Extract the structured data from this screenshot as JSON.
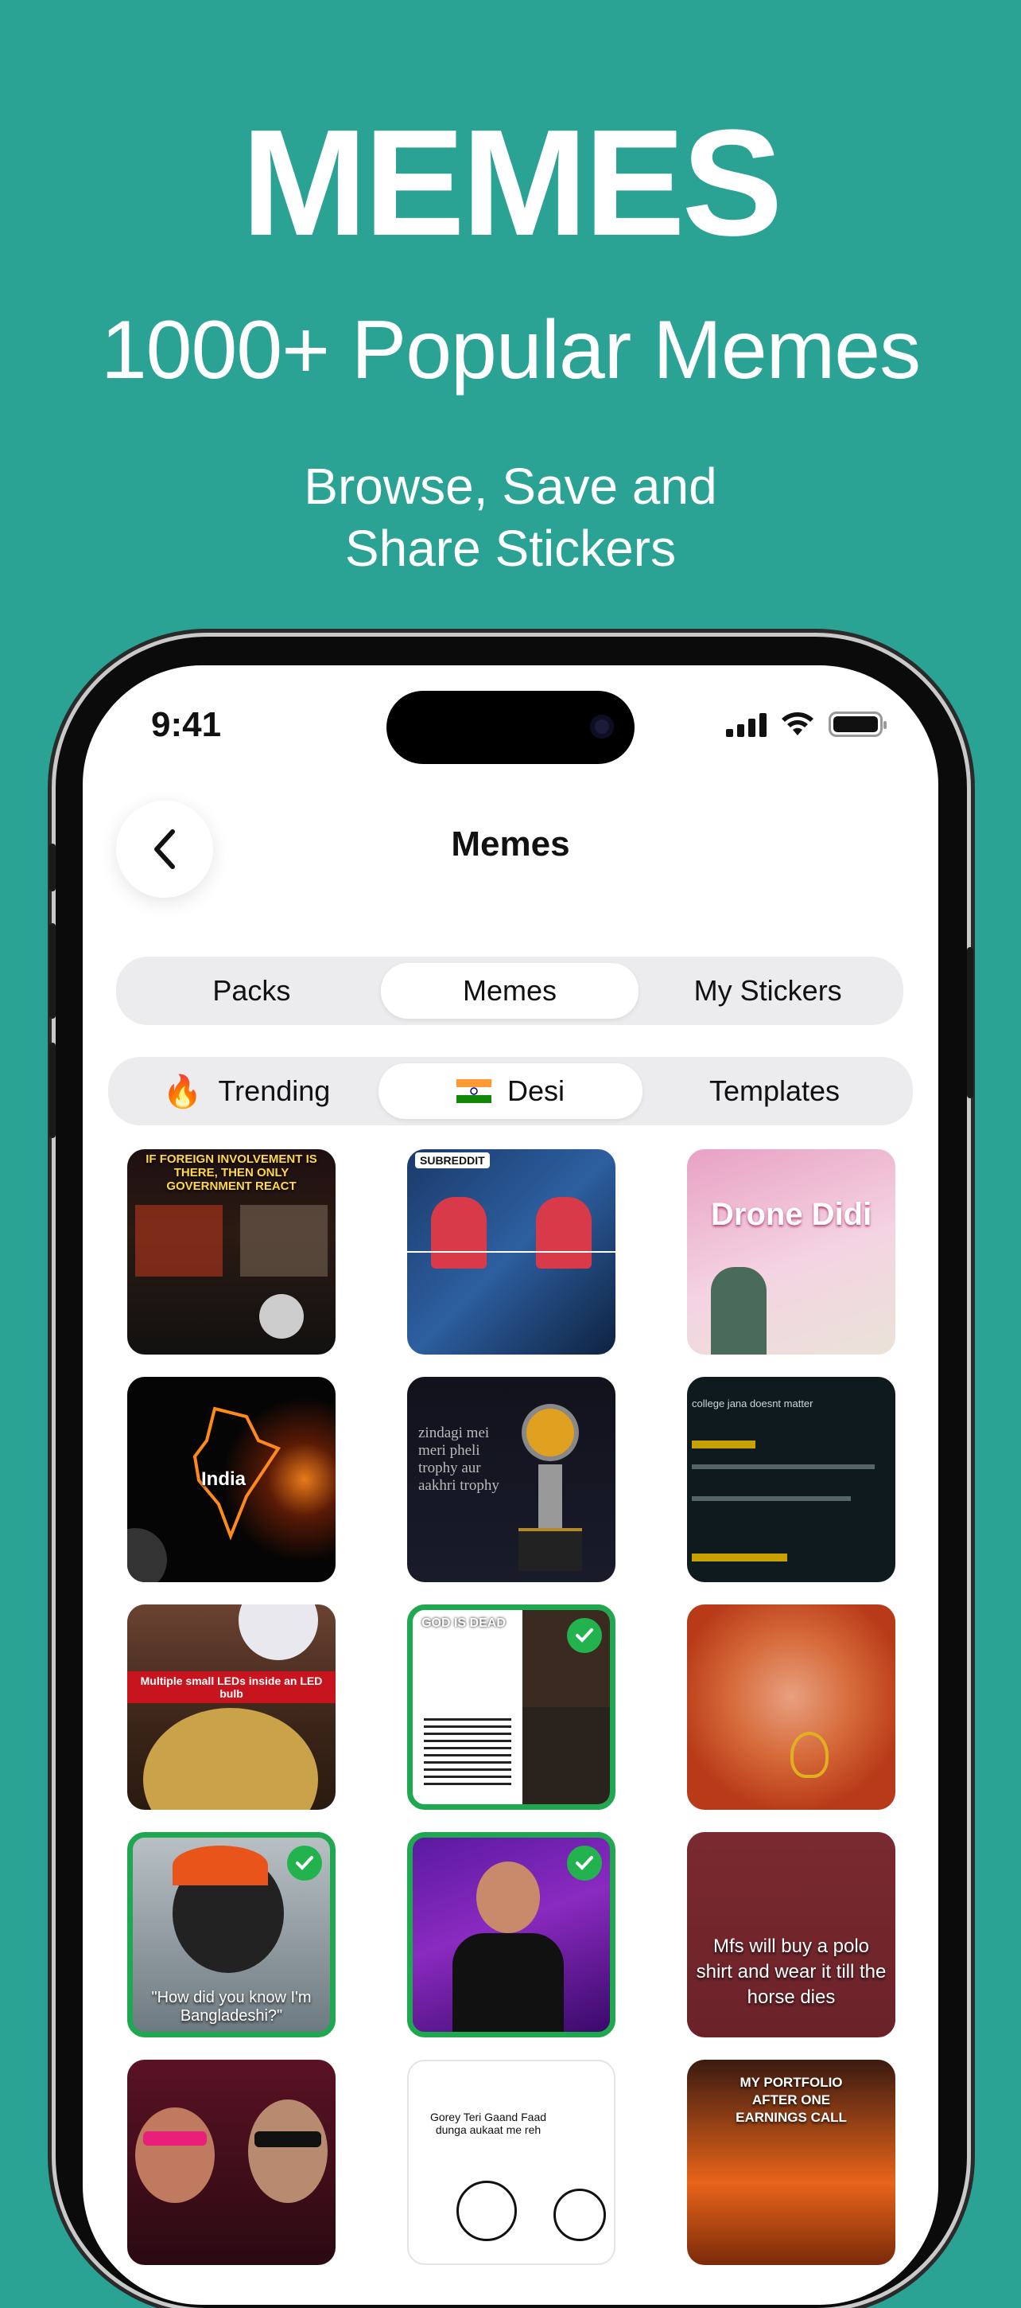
{
  "hero": {
    "title": "MEMES",
    "subtitle": "1000+ Popular Memes",
    "desc_line1": "Browse, Save and",
    "desc_line2": "Share Stickers"
  },
  "status_bar": {
    "time": "9:41"
  },
  "nav": {
    "title": "Memes"
  },
  "top_tabs": [
    {
      "label": "Packs",
      "active": false
    },
    {
      "label": "Memes",
      "active": true
    },
    {
      "label": "My Stickers",
      "active": false
    }
  ],
  "filters": [
    {
      "emoji": "🔥",
      "label": "Trending",
      "active": false
    },
    {
      "emoji": "🇮🇳",
      "label": "Desi",
      "active": true
    },
    {
      "label": "Templates",
      "active": false
    }
  ],
  "memes": [
    {
      "caption": "IF FOREIGN INVOLVEMENT IS THERE, THEN ONLY GOVERNMENT REACT",
      "selected": false
    },
    {
      "caption": "SUBREDDIT",
      "selected": false
    },
    {
      "caption": "Drone Didi",
      "selected": false
    },
    {
      "caption": "India",
      "selected": false
    },
    {
      "caption": "zindagi mei meri pheli trophy aur aakhri trophy",
      "selected": false
    },
    {
      "caption": "college jana doesnt matter",
      "selected": false
    },
    {
      "caption": "Multiple small LEDs inside an LED bulb",
      "selected": false
    },
    {
      "caption": "GOD IS DEAD",
      "selected": true
    },
    {
      "caption": "",
      "selected": false
    },
    {
      "caption": "\"How did you know I'm Bangladeshi?\"",
      "selected": true
    },
    {
      "caption": "",
      "selected": true
    },
    {
      "caption": "Mfs will buy a polo shirt and wear it till the horse dies",
      "selected": false
    },
    {
      "caption": "",
      "selected": false
    },
    {
      "caption": "Gorey Teri Gaand Faad dunga aukaat me reh",
      "selected": false
    },
    {
      "caption": "MY PORTFOLIO AFTER ONE EARNINGS CALL",
      "selected": false
    }
  ],
  "colors": {
    "background": "#2aa395",
    "selected_border": "#1fa84f",
    "check": "#22b34f"
  }
}
